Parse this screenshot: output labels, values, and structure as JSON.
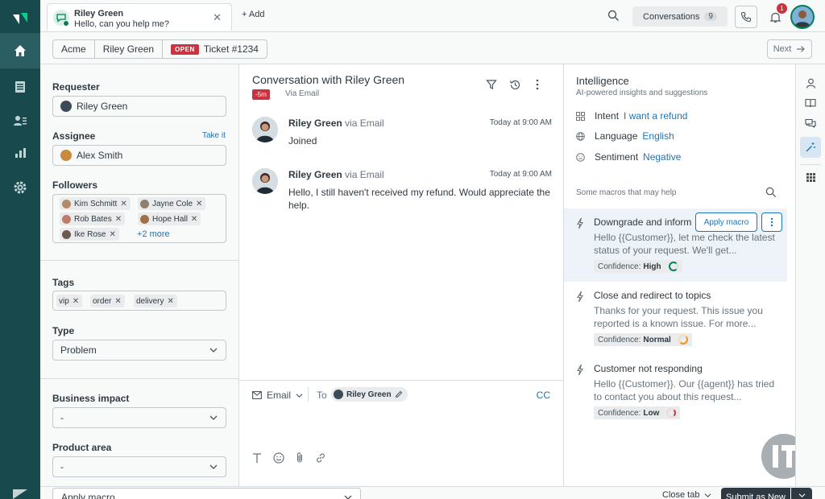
{
  "tab": {
    "name": "Riley Green",
    "preview": "Hello, can you help me?",
    "add_label": "+ Add"
  },
  "topbar": {
    "conversations_label": "Conversations",
    "conversations_count": "9",
    "notifications_count": "1"
  },
  "breadcrumb": {
    "org": "Acme",
    "requester": "Riley Green",
    "status": "OPEN",
    "ticket": "Ticket #1234",
    "next_label": "Next"
  },
  "properties": {
    "requester_label": "Requester",
    "requester_value": "Riley Green",
    "assignee_label": "Assignee",
    "take_it": "Take it",
    "assignee_value": "Alex Smith",
    "followers_label": "Followers",
    "followers": [
      "Kim Schmitt",
      "Jayne Cole",
      "Rob Bates",
      "Hope Hall",
      "Ike Rose"
    ],
    "followers_more": "+2 more",
    "tags_label": "Tags",
    "tags": [
      "vip",
      "order",
      "delivery"
    ],
    "type_label": "Type",
    "type_value": "Problem",
    "impact_label": "Business impact",
    "impact_value": "-",
    "product_label": "Product area",
    "product_value": "-"
  },
  "conversation": {
    "title": "Conversation with Riley Green",
    "age_badge": "-5m",
    "channel": "Via Email",
    "messages": [
      {
        "author": "Riley Green",
        "via": "via Email",
        "time": "Today at 9:00 AM",
        "body": "Joined"
      },
      {
        "author": "Riley Green",
        "via": "via Email",
        "time": "Today at 9:00 AM",
        "body": "Hello, I still haven't received my refund. Would appreciate the help."
      }
    ],
    "composer": {
      "channel": "Email",
      "to_label": "To",
      "recipient": "Riley Green",
      "cc": "CC"
    }
  },
  "intelligence": {
    "title": "Intelligence",
    "subtitle": "AI-powered insights and suggestions",
    "intent_label": "Intent",
    "intent_value": "I want a refund",
    "language_label": "Language",
    "language_value": "English",
    "sentiment_label": "Sentiment",
    "sentiment_value": "Negative",
    "macros_heading": "Some macros that may help",
    "apply_label": "Apply macro",
    "macros": [
      {
        "title": "Downgrade and inform",
        "body": "Hello {{Customer}}, let me check the latest status of your request. We'll get...",
        "confidence_label": "Confidence:",
        "confidence": "High",
        "color": "#038153"
      },
      {
        "title": "Close and redirect to topics",
        "body": "Thanks for your request. This issue you reported is a known issue. For more...",
        "confidence_label": "Confidence:",
        "confidence": "Normal",
        "color": "#ed961c"
      },
      {
        "title": "Customer not responding",
        "body": "Hello {{Customer}}. Our {{agent}} has tried to contact you about this request...",
        "confidence_label": "Confidence:",
        "confidence": "Low",
        "color": "#cc3340"
      }
    ]
  },
  "bottombar": {
    "apply_macro": "Apply macro",
    "close_tab": "Close tab",
    "submit": "Submit as New"
  },
  "colors": {
    "nav": "#17494d",
    "accent": "#1f73b7",
    "danger": "#cc3340",
    "success": "#038153"
  }
}
